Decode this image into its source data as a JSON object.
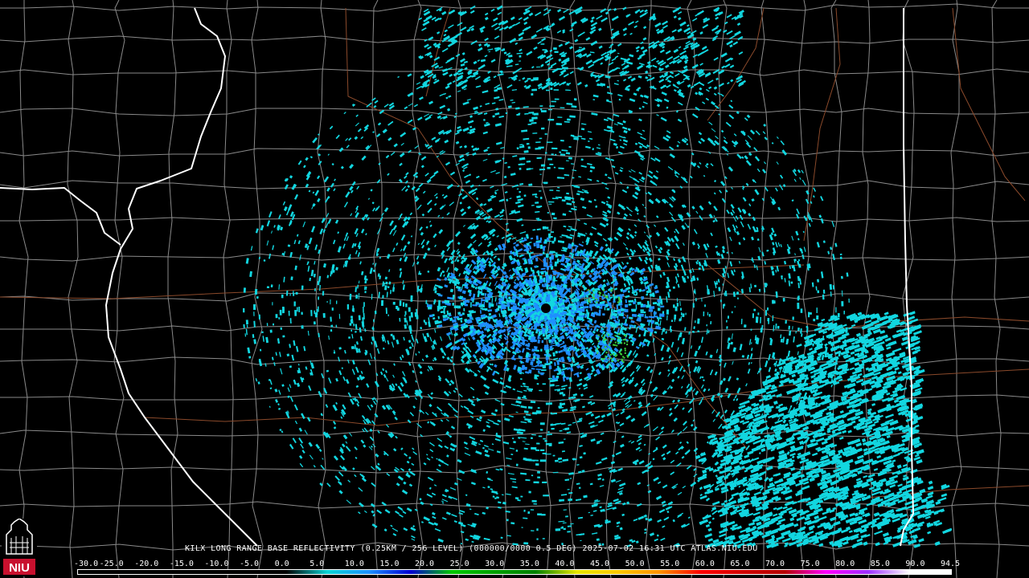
{
  "product_caption": "KILX LONG RANGE BASE REFLECTIVITY (0.25KM / 256 LEVEL) (000000/0000 0.5 DEG) 2025-07-02 16:31 UTC  ATLAS.NIU.EDU",
  "logo": {
    "text": "NIU",
    "color": "#c8102e"
  },
  "color_scale": {
    "labels": [
      "-30.0",
      "-25.0",
      "-20.0",
      "-15.0",
      "-10.0",
      "-5.0",
      "0.0",
      "5.0",
      "10.0",
      "15.0",
      "20.0",
      "25.0",
      "30.0",
      "35.0",
      "40.0",
      "45.0",
      "50.0",
      "55.0",
      "60.0",
      "65.0",
      "70.0",
      "75.0",
      "80.0",
      "85.0",
      "90.0",
      "94.5"
    ],
    "colors": [
      "#000000",
      "#000000",
      "#000000",
      "#000000",
      "#000000",
      "#000000",
      "#0bd3d3",
      "#1e90ff",
      "#0000d0",
      "#00c800",
      "#00a000",
      "#008000",
      "#e6e600",
      "#ffc800",
      "#ff9000",
      "#ff0000",
      "#d00000",
      "#b40000",
      "#ff00ff",
      "#9b30ff",
      "#ffffff",
      "#ffffff"
    ]
  },
  "map_colors": {
    "state_border": "#ffffff",
    "county_border": "#8a8a8a",
    "road": "#8b4a2b",
    "echo_primary": "#12d6e0",
    "echo_secondary": "#1e8fff",
    "echo_green": "#3ccf3c"
  },
  "radar_site_icon": "radar-site-dot-icon"
}
